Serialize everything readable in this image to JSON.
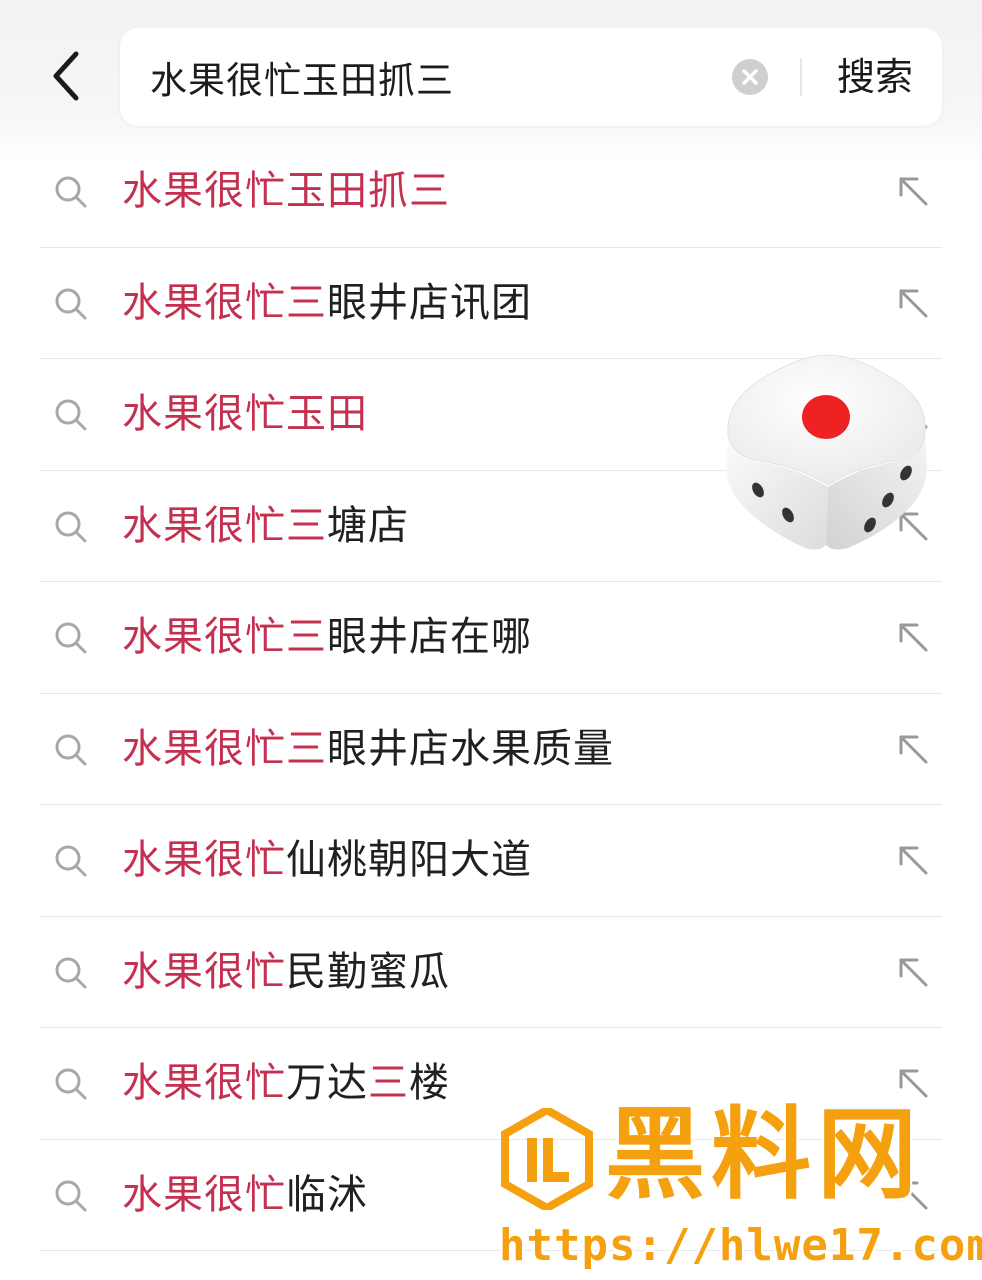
{
  "search": {
    "value": "水果很忙玉田抓三",
    "button_label": "搜索"
  },
  "suggestions": [
    {
      "highlight": "水果很忙玉田抓三",
      "rest": "",
      "highlight2": "",
      "rest2": ""
    },
    {
      "highlight": "水果很忙三",
      "rest": "眼井店讯团",
      "highlight2": "",
      "rest2": ""
    },
    {
      "highlight": "水果很忙玉田",
      "rest": "",
      "highlight2": "",
      "rest2": ""
    },
    {
      "highlight": "水果很忙三",
      "rest": "塘店",
      "highlight2": "",
      "rest2": ""
    },
    {
      "highlight": "水果很忙三",
      "rest": "眼井店在哪",
      "highlight2": "",
      "rest2": ""
    },
    {
      "highlight": "水果很忙三",
      "rest": "眼井店水果质量",
      "highlight2": "",
      "rest2": ""
    },
    {
      "highlight": "水果很忙",
      "rest": "仙桃朝阳大道",
      "highlight2": "",
      "rest2": ""
    },
    {
      "highlight": "水果很忙",
      "rest": "民勤蜜瓜",
      "highlight2": "",
      "rest2": ""
    },
    {
      "highlight": "水果很忙",
      "rest": "万达",
      "highlight2": "三",
      "rest2": "楼"
    },
    {
      "highlight": "水果很忙",
      "rest": "临沭",
      "highlight2": "",
      "rest2": ""
    }
  ],
  "watermark": {
    "title": "黑料网",
    "url": "https://hlwe17.com"
  },
  "colors": {
    "highlight": "#c4304f",
    "text": "#202020",
    "watermark": "#f5a00f",
    "dice_pip": "#ee2222"
  }
}
